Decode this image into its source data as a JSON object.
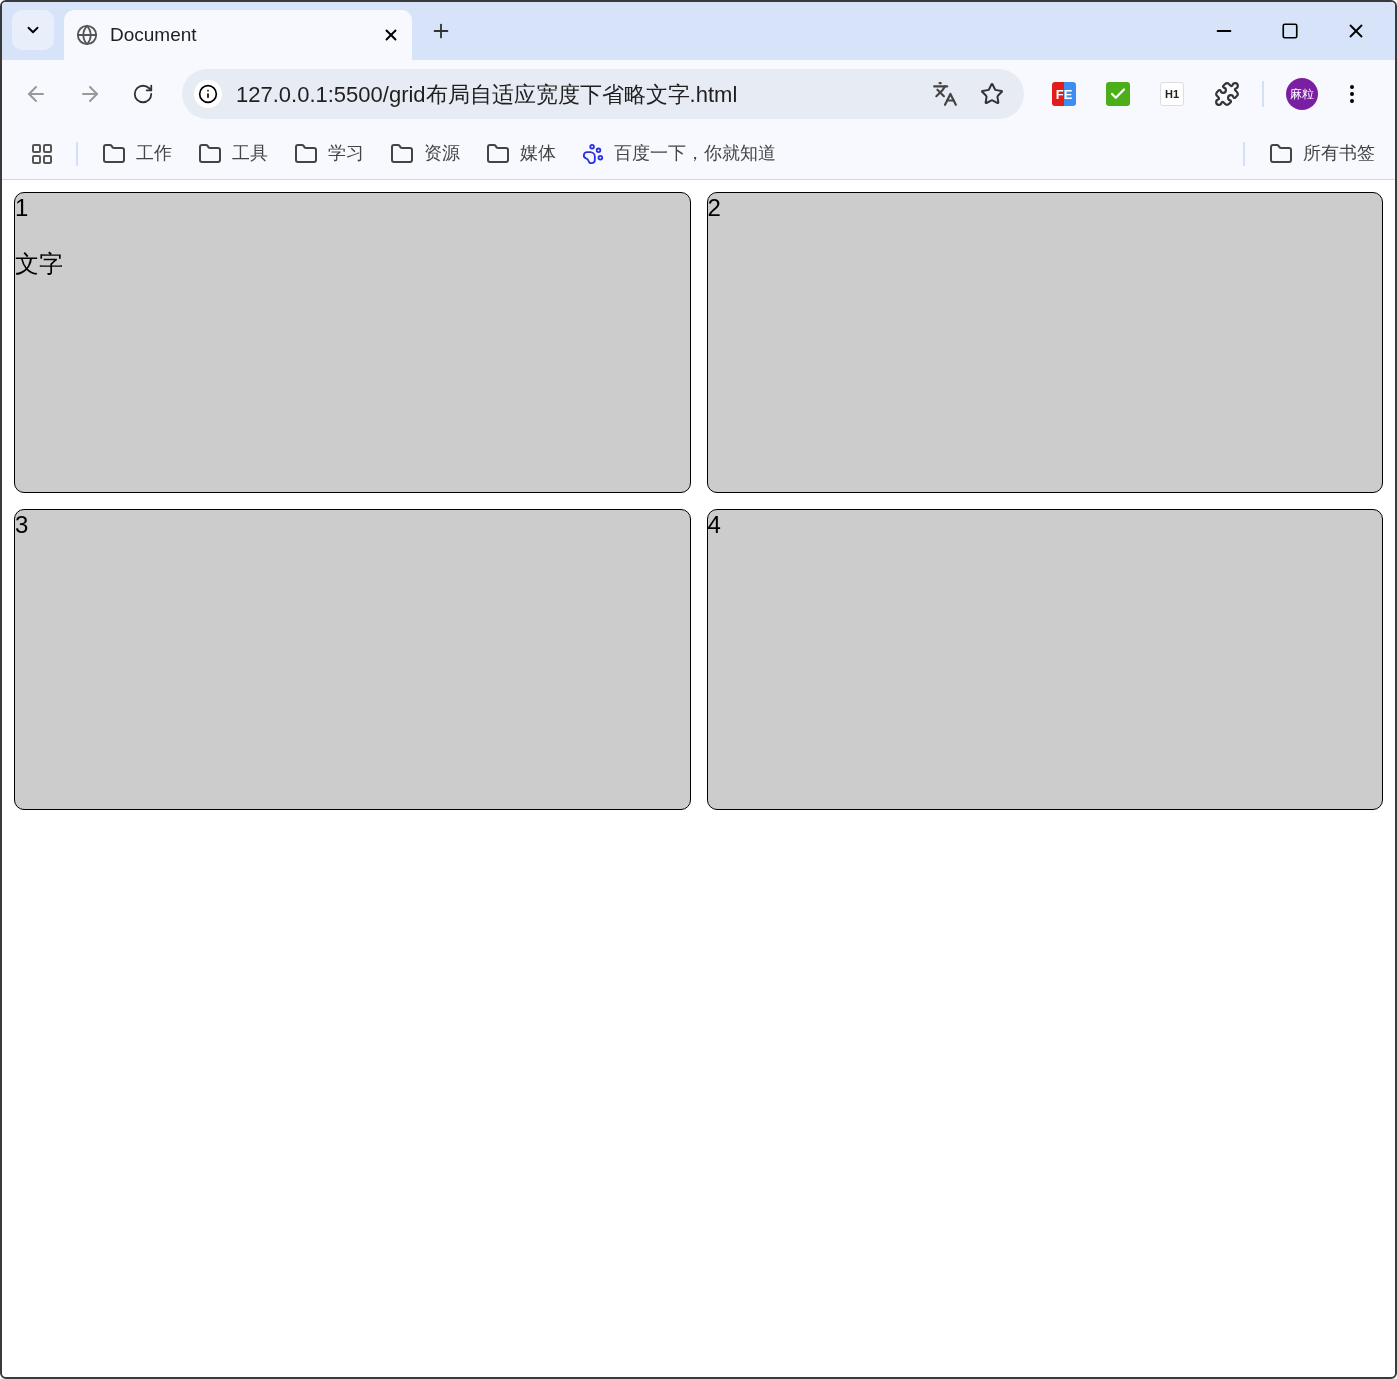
{
  "tab": {
    "title": "Document",
    "selected": true
  },
  "address": {
    "url": "127.0.0.1:5500/grid布局自适应宽度下省略文字.html"
  },
  "extensions": [
    {
      "kind": "fe",
      "label": "FE"
    },
    {
      "kind": "check"
    },
    {
      "kind": "h1",
      "label": "H1"
    }
  ],
  "profile": {
    "label": "麻粒"
  },
  "bookmarks": [
    {
      "kind": "folder",
      "label": "工作"
    },
    {
      "kind": "folder",
      "label": "工具"
    },
    {
      "kind": "folder",
      "label": "学习"
    },
    {
      "kind": "folder",
      "label": "资源"
    },
    {
      "kind": "folder",
      "label": "媒体"
    },
    {
      "kind": "site",
      "label": "百度一下，你就知道"
    }
  ],
  "all_bookmarks": {
    "label": "所有书签"
  },
  "cards": [
    {
      "title": "1",
      "text": "文字"
    },
    {
      "title": "2"
    },
    {
      "title": "3"
    },
    {
      "title": "4"
    }
  ]
}
